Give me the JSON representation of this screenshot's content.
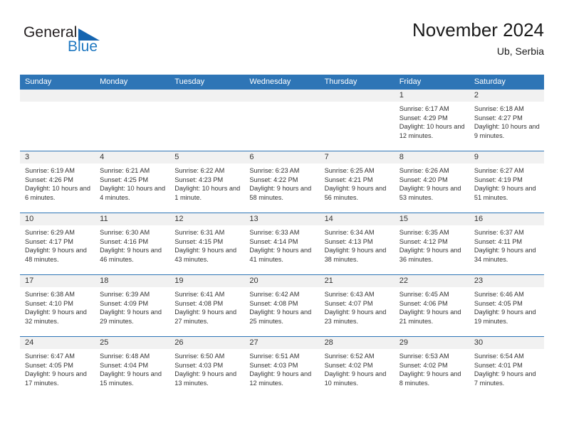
{
  "brand": {
    "name_part1": "General",
    "name_part2": "Blue",
    "accent_color": "#1f78c1",
    "triangle_color": "#1565b0"
  },
  "header": {
    "title": "November 2024",
    "subtitle": "Ub, Serbia"
  },
  "theme": {
    "header_row_bg": "#2e75b6",
    "daynum_band_bg": "#f1f1f1",
    "cell_bg": "#ffffff",
    "text_color": "#333333"
  },
  "weekday_headers": [
    "Sunday",
    "Monday",
    "Tuesday",
    "Wednesday",
    "Thursday",
    "Friday",
    "Saturday"
  ],
  "labels": {
    "sunrise_prefix": "Sunrise:",
    "sunset_prefix": "Sunset:",
    "daylight_prefix": "Daylight:"
  },
  "weeks": [
    [
      {
        "day": "",
        "sunrise": "",
        "sunset": "",
        "daylight": "",
        "empty": true
      },
      {
        "day": "",
        "sunrise": "",
        "sunset": "",
        "daylight": "",
        "empty": true
      },
      {
        "day": "",
        "sunrise": "",
        "sunset": "",
        "daylight": "",
        "empty": true
      },
      {
        "day": "",
        "sunrise": "",
        "sunset": "",
        "daylight": "",
        "empty": true
      },
      {
        "day": "",
        "sunrise": "",
        "sunset": "",
        "daylight": "",
        "empty": true
      },
      {
        "day": "1",
        "sunrise": "Sunrise: 6:17 AM",
        "sunset": "Sunset: 4:29 PM",
        "daylight": "Daylight: 10 hours and 12 minutes.",
        "empty": false
      },
      {
        "day": "2",
        "sunrise": "Sunrise: 6:18 AM",
        "sunset": "Sunset: 4:27 PM",
        "daylight": "Daylight: 10 hours and 9 minutes.",
        "empty": false
      }
    ],
    [
      {
        "day": "3",
        "sunrise": "Sunrise: 6:19 AM",
        "sunset": "Sunset: 4:26 PM",
        "daylight": "Daylight: 10 hours and 6 minutes.",
        "empty": false
      },
      {
        "day": "4",
        "sunrise": "Sunrise: 6:21 AM",
        "sunset": "Sunset: 4:25 PM",
        "daylight": "Daylight: 10 hours and 4 minutes.",
        "empty": false
      },
      {
        "day": "5",
        "sunrise": "Sunrise: 6:22 AM",
        "sunset": "Sunset: 4:23 PM",
        "daylight": "Daylight: 10 hours and 1 minute.",
        "empty": false
      },
      {
        "day": "6",
        "sunrise": "Sunrise: 6:23 AM",
        "sunset": "Sunset: 4:22 PM",
        "daylight": "Daylight: 9 hours and 58 minutes.",
        "empty": false
      },
      {
        "day": "7",
        "sunrise": "Sunrise: 6:25 AM",
        "sunset": "Sunset: 4:21 PM",
        "daylight": "Daylight: 9 hours and 56 minutes.",
        "empty": false
      },
      {
        "day": "8",
        "sunrise": "Sunrise: 6:26 AM",
        "sunset": "Sunset: 4:20 PM",
        "daylight": "Daylight: 9 hours and 53 minutes.",
        "empty": false
      },
      {
        "day": "9",
        "sunrise": "Sunrise: 6:27 AM",
        "sunset": "Sunset: 4:19 PM",
        "daylight": "Daylight: 9 hours and 51 minutes.",
        "empty": false
      }
    ],
    [
      {
        "day": "10",
        "sunrise": "Sunrise: 6:29 AM",
        "sunset": "Sunset: 4:17 PM",
        "daylight": "Daylight: 9 hours and 48 minutes.",
        "empty": false
      },
      {
        "day": "11",
        "sunrise": "Sunrise: 6:30 AM",
        "sunset": "Sunset: 4:16 PM",
        "daylight": "Daylight: 9 hours and 46 minutes.",
        "empty": false
      },
      {
        "day": "12",
        "sunrise": "Sunrise: 6:31 AM",
        "sunset": "Sunset: 4:15 PM",
        "daylight": "Daylight: 9 hours and 43 minutes.",
        "empty": false
      },
      {
        "day": "13",
        "sunrise": "Sunrise: 6:33 AM",
        "sunset": "Sunset: 4:14 PM",
        "daylight": "Daylight: 9 hours and 41 minutes.",
        "empty": false
      },
      {
        "day": "14",
        "sunrise": "Sunrise: 6:34 AM",
        "sunset": "Sunset: 4:13 PM",
        "daylight": "Daylight: 9 hours and 38 minutes.",
        "empty": false
      },
      {
        "day": "15",
        "sunrise": "Sunrise: 6:35 AM",
        "sunset": "Sunset: 4:12 PM",
        "daylight": "Daylight: 9 hours and 36 minutes.",
        "empty": false
      },
      {
        "day": "16",
        "sunrise": "Sunrise: 6:37 AM",
        "sunset": "Sunset: 4:11 PM",
        "daylight": "Daylight: 9 hours and 34 minutes.",
        "empty": false
      }
    ],
    [
      {
        "day": "17",
        "sunrise": "Sunrise: 6:38 AM",
        "sunset": "Sunset: 4:10 PM",
        "daylight": "Daylight: 9 hours and 32 minutes.",
        "empty": false
      },
      {
        "day": "18",
        "sunrise": "Sunrise: 6:39 AM",
        "sunset": "Sunset: 4:09 PM",
        "daylight": "Daylight: 9 hours and 29 minutes.",
        "empty": false
      },
      {
        "day": "19",
        "sunrise": "Sunrise: 6:41 AM",
        "sunset": "Sunset: 4:08 PM",
        "daylight": "Daylight: 9 hours and 27 minutes.",
        "empty": false
      },
      {
        "day": "20",
        "sunrise": "Sunrise: 6:42 AM",
        "sunset": "Sunset: 4:08 PM",
        "daylight": "Daylight: 9 hours and 25 minutes.",
        "empty": false
      },
      {
        "day": "21",
        "sunrise": "Sunrise: 6:43 AM",
        "sunset": "Sunset: 4:07 PM",
        "daylight": "Daylight: 9 hours and 23 minutes.",
        "empty": false
      },
      {
        "day": "22",
        "sunrise": "Sunrise: 6:45 AM",
        "sunset": "Sunset: 4:06 PM",
        "daylight": "Daylight: 9 hours and 21 minutes.",
        "empty": false
      },
      {
        "day": "23",
        "sunrise": "Sunrise: 6:46 AM",
        "sunset": "Sunset: 4:05 PM",
        "daylight": "Daylight: 9 hours and 19 minutes.",
        "empty": false
      }
    ],
    [
      {
        "day": "24",
        "sunrise": "Sunrise: 6:47 AM",
        "sunset": "Sunset: 4:05 PM",
        "daylight": "Daylight: 9 hours and 17 minutes.",
        "empty": false
      },
      {
        "day": "25",
        "sunrise": "Sunrise: 6:48 AM",
        "sunset": "Sunset: 4:04 PM",
        "daylight": "Daylight: 9 hours and 15 minutes.",
        "empty": false
      },
      {
        "day": "26",
        "sunrise": "Sunrise: 6:50 AM",
        "sunset": "Sunset: 4:03 PM",
        "daylight": "Daylight: 9 hours and 13 minutes.",
        "empty": false
      },
      {
        "day": "27",
        "sunrise": "Sunrise: 6:51 AM",
        "sunset": "Sunset: 4:03 PM",
        "daylight": "Daylight: 9 hours and 12 minutes.",
        "empty": false
      },
      {
        "day": "28",
        "sunrise": "Sunrise: 6:52 AM",
        "sunset": "Sunset: 4:02 PM",
        "daylight": "Daylight: 9 hours and 10 minutes.",
        "empty": false
      },
      {
        "day": "29",
        "sunrise": "Sunrise: 6:53 AM",
        "sunset": "Sunset: 4:02 PM",
        "daylight": "Daylight: 9 hours and 8 minutes.",
        "empty": false
      },
      {
        "day": "30",
        "sunrise": "Sunrise: 6:54 AM",
        "sunset": "Sunset: 4:01 PM",
        "daylight": "Daylight: 9 hours and 7 minutes.",
        "empty": false
      }
    ]
  ]
}
